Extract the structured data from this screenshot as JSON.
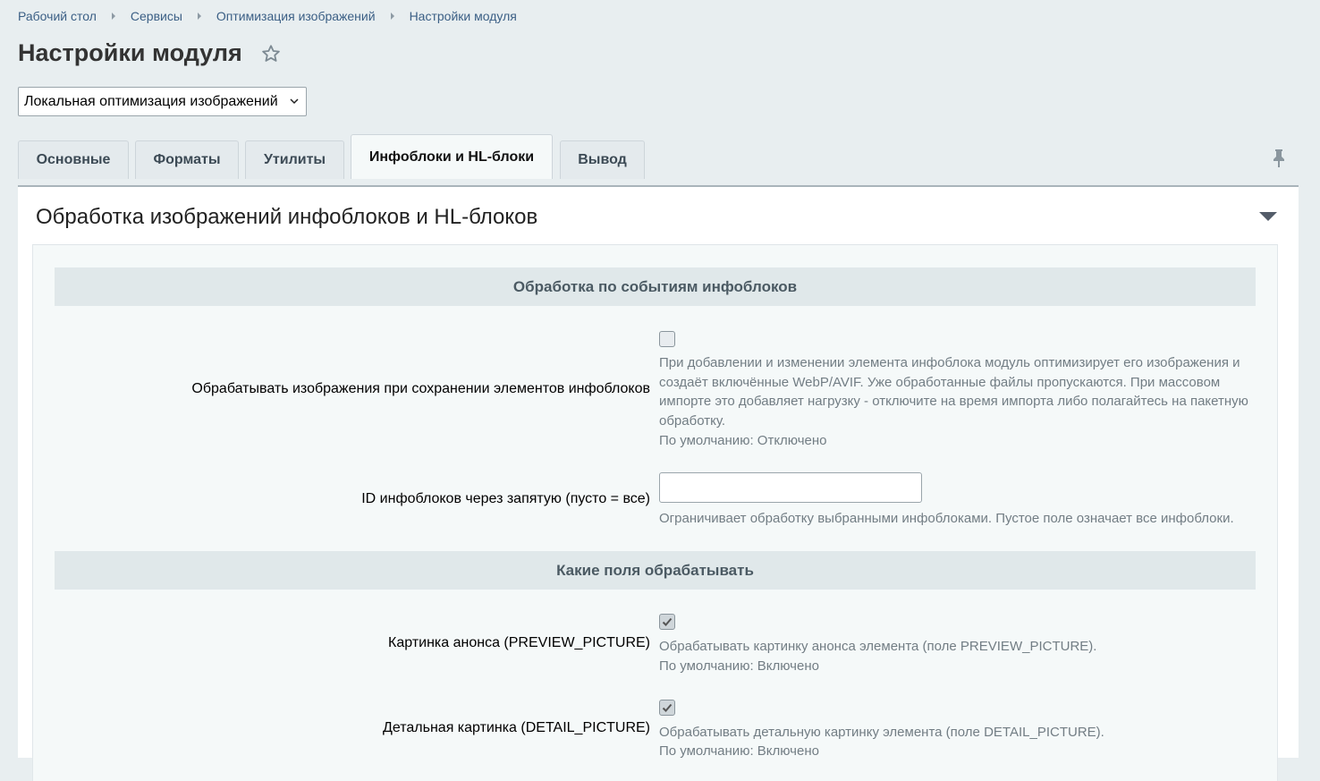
{
  "breadcrumb": [
    "Рабочий стол",
    "Сервисы",
    "Оптимизация изображений",
    "Настройки модуля"
  ],
  "page_title": "Настройки модуля",
  "module_select": {
    "value": "Локальная оптимизация изображений"
  },
  "tabs": [
    {
      "label": "Основные",
      "active": false
    },
    {
      "label": "Форматы",
      "active": false
    },
    {
      "label": "Утилиты",
      "active": false
    },
    {
      "label": "Инфоблоки и HL-блоки",
      "active": true
    },
    {
      "label": "Вывод",
      "active": false
    }
  ],
  "panel": {
    "title": "Обработка изображений инфоблоков и HL-блоков",
    "sections": [
      {
        "title": "Обработка по событиям инфоблоков"
      },
      {
        "title": "Какие поля обрабатывать"
      }
    ],
    "fields": {
      "process_on_save": {
        "label": "Обрабатывать изображения при сохранении элементов инфоблоков",
        "checked": false,
        "hint": "При добавлении и изменении элемента инфоблока модуль оптимизирует его изображения и создаёт включённые WebP/AVIF. Уже обработанные файлы пропускаются. При массовом импорте это добавляет нагрузку - отключите на время импорта либо полагайтесь на пакетную обработку.",
        "default": "По умолчанию: Отключено"
      },
      "iblock_ids": {
        "label": "ID инфоблоков через запятую (пусто = все)",
        "value": "",
        "hint": "Ограничивает обработку выбранными инфоблоками. Пустое поле означает все инфоблоки."
      },
      "preview_picture": {
        "label": "Картинка анонса (PREVIEW_PICTURE)",
        "checked": true,
        "hint": "Обрабатывать картинку анонса элемента (поле PREVIEW_PICTURE).",
        "default": "По умолчанию: Включено"
      },
      "detail_picture": {
        "label": "Детальная картинка (DETAIL_PICTURE)",
        "checked": true,
        "hint": "Обрабатывать детальную картинку элемента (поле DETAIL_PICTURE).",
        "default": "По умолчанию: Включено"
      }
    }
  },
  "icons": {
    "favorite": "star-outline-icon",
    "pin": "pin-icon",
    "collapse": "triangle-down-icon",
    "select": "chevron-down-icon"
  }
}
